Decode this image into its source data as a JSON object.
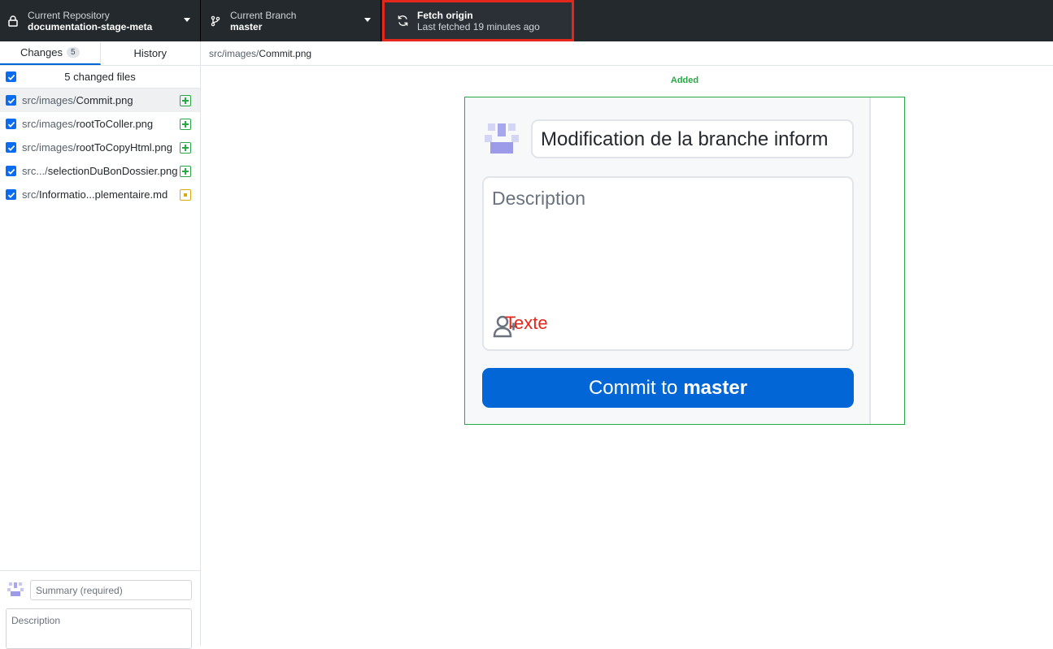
{
  "toolbar": {
    "repo_label": "Current Repository",
    "repo_name": "documentation-stage-meta",
    "branch_label": "Current Branch",
    "branch_name": "master",
    "fetch_title": "Fetch origin",
    "fetch_subtitle": "Last fetched 19 minutes ago"
  },
  "sidebar": {
    "tabs": [
      {
        "label": "Changes",
        "count": "5"
      },
      {
        "label": "History"
      }
    ],
    "changed_files_label": "5 changed files",
    "files": [
      {
        "dir": "src/images/",
        "name": "Commit.png",
        "status": "added"
      },
      {
        "dir": "src/images/",
        "name": "rootToColler.png",
        "status": "added"
      },
      {
        "dir": "src/images/",
        "name": "rootToCopyHtml.png",
        "status": "added"
      },
      {
        "dir": "src.../",
        "name": "selectionDuBonDossier.png",
        "status": "added"
      },
      {
        "dir": "src/",
        "name": "Informatio...plementaire.md",
        "status": "modified"
      }
    ],
    "summary_placeholder": "Summary (required)",
    "description_placeholder": "Description"
  },
  "main": {
    "path_dir": "src/images/",
    "path_file": "Commit.png",
    "diff_label": "Added",
    "image": {
      "summary_text": "Modification de la branche inform",
      "description_text": "Description",
      "annotation": "Texte",
      "commit_prefix": "Commit to",
      "commit_branch": "master"
    }
  },
  "colors": {
    "toolbar_bg": "#24292e",
    "highlight_border": "#e3271a",
    "added_green": "#28a745",
    "modified_yellow": "#dbab09",
    "primary_blue": "#0366d6",
    "checkbox_blue": "#0b6cf0"
  }
}
